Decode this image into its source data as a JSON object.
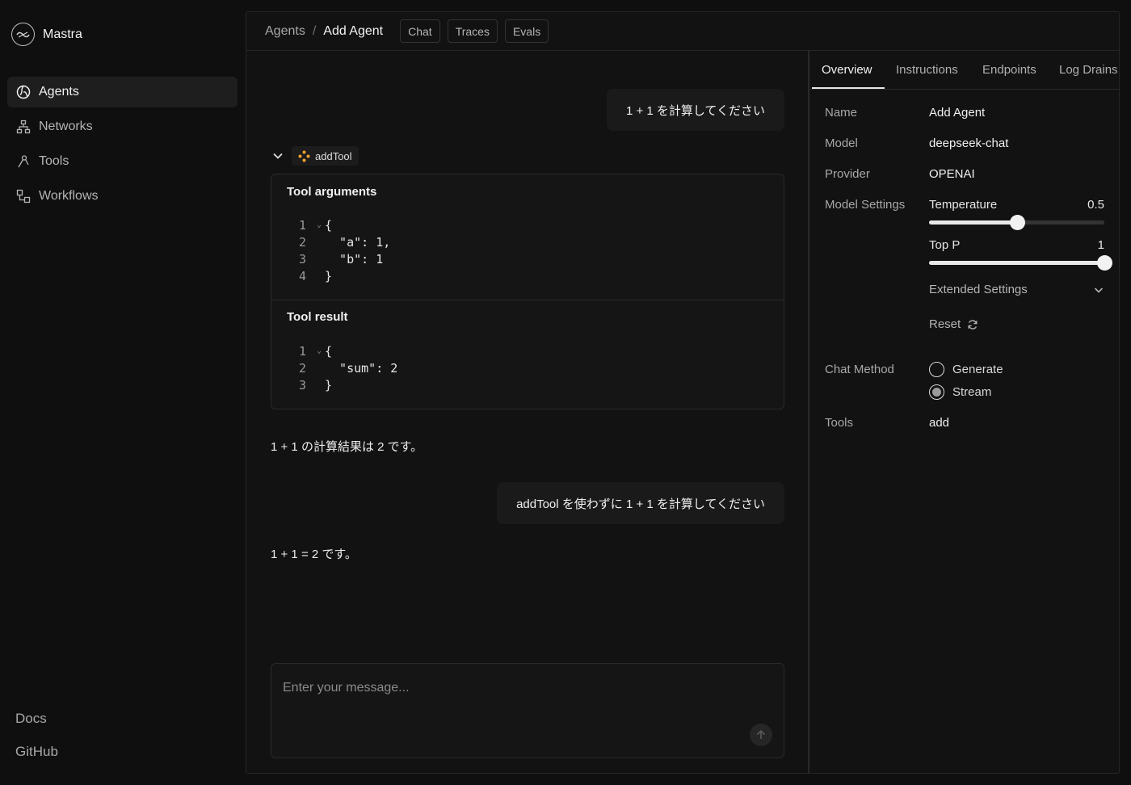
{
  "brand": {
    "name": "Mastra"
  },
  "sidebar": {
    "items": [
      {
        "label": "Agents",
        "icon": "globe-icon",
        "active": true
      },
      {
        "label": "Networks",
        "icon": "network-icon"
      },
      {
        "label": "Tools",
        "icon": "tool-icon"
      },
      {
        "label": "Workflows",
        "icon": "workflow-icon"
      }
    ],
    "footer": {
      "docs": "Docs",
      "github": "GitHub"
    }
  },
  "header": {
    "breadcrumb_parent": "Agents",
    "breadcrumb_sep": "/",
    "breadcrumb_current": "Add Agent",
    "tabs": [
      "Chat",
      "Traces",
      "Evals"
    ]
  },
  "chat": {
    "user_message_1": "1 + 1 を計算してください",
    "tool_name": "addTool",
    "tool_arguments_title": "Tool arguments",
    "tool_arguments_lines": [
      {
        "n": "1",
        "text": "{"
      },
      {
        "n": "2",
        "text": "  \"a\": 1,"
      },
      {
        "n": "3",
        "text": "  \"b\": 1"
      },
      {
        "n": "4",
        "text": "}"
      }
    ],
    "tool_result_title": "Tool result",
    "tool_result_lines": [
      {
        "n": "1",
        "text": "{"
      },
      {
        "n": "2",
        "text": "  \"sum\": 2"
      },
      {
        "n": "3",
        "text": "}"
      }
    ],
    "assistant_message_1": "1 + 1 の計算結果は 2 です。",
    "user_message_2": "addTool を使わずに 1 + 1 を計算してください",
    "assistant_message_2": "1 + 1 = 2 です。",
    "input_placeholder": "Enter your message..."
  },
  "panel": {
    "tabs": [
      "Overview",
      "Instructions",
      "Endpoints",
      "Log Drains"
    ],
    "name_label": "Name",
    "name_value": "Add Agent",
    "model_label": "Model",
    "model_value": "deepseek-chat",
    "provider_label": "Provider",
    "provider_value": "OPENAI",
    "model_settings_label": "Model Settings",
    "temperature_label": "Temperature",
    "temperature_value": "0.5",
    "temperature_fraction": 0.5,
    "top_p_label": "Top P",
    "top_p_value": "1",
    "top_p_fraction": 1.0,
    "extended_settings": "Extended Settings",
    "reset_label": "Reset",
    "chat_method_label": "Chat Method",
    "chat_methods": [
      "Generate",
      "Stream"
    ],
    "chat_method_selected": "Stream",
    "tools_label": "Tools",
    "tools_value": "add"
  },
  "colors": {
    "accent_tool_icon": "#f0a030",
    "background": "#0f0f0f",
    "panel": "#121212"
  }
}
